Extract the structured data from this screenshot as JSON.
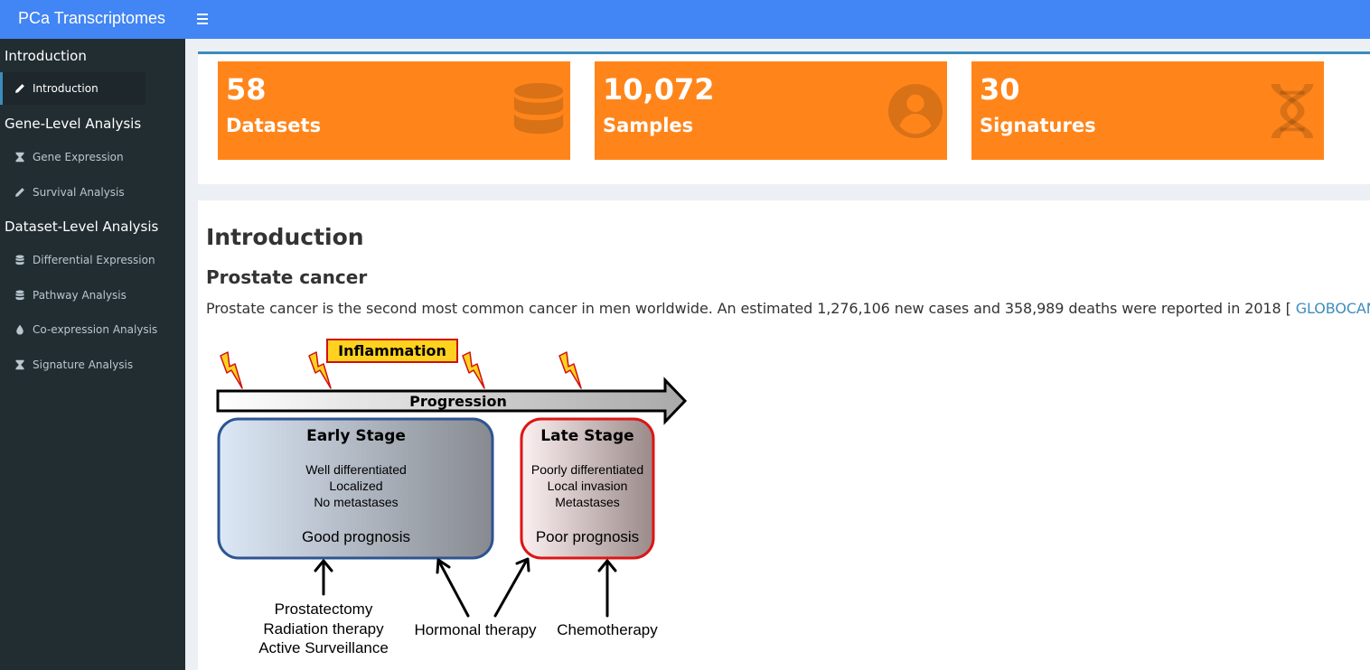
{
  "app": {
    "title": "PCa Transcriptomes"
  },
  "sidebar": {
    "sections": [
      {
        "label": "Introduction"
      },
      {
        "label": "Gene-Level Analysis"
      },
      {
        "label": "Dataset-Level Analysis"
      }
    ],
    "items": [
      {
        "label": "Introduction",
        "icon": "pencil-icon"
      },
      {
        "label": "Gene Expression",
        "icon": "hourglass-icon"
      },
      {
        "label": "Survival Analysis",
        "icon": "pencil-icon"
      },
      {
        "label": "Differential Expression",
        "icon": "database-icon"
      },
      {
        "label": "Pathway Analysis",
        "icon": "database-icon"
      },
      {
        "label": "Co-expression Analysis",
        "icon": "drop-icon"
      },
      {
        "label": "Signature Analysis",
        "icon": "hourglass-icon"
      }
    ]
  },
  "stats": [
    {
      "value": "58",
      "label": "Datasets",
      "icon": "database-icon"
    },
    {
      "value": "10,072",
      "label": "Samples",
      "icon": "user-icon"
    },
    {
      "value": "30",
      "label": "Signatures",
      "icon": "dna-icon"
    }
  ],
  "content": {
    "title": "Introduction",
    "subtitle": "Prostate cancer",
    "paragraph_text": "Prostate cancer is the second most common cancer in men worldwide. An estimated 1,276,106 new cases and 358,989 deaths were reported in 2018 [ ",
    "paragraph_link": "GLOBOCAN",
    "paragraph_end": " ]."
  },
  "figure": {
    "inflammation": "Inflammation",
    "progression": "Progression",
    "early": {
      "title": "Early Stage",
      "lines": [
        "Well differentiated",
        "Localized",
        "No metastases"
      ],
      "prognosis": "Good prognosis"
    },
    "late": {
      "title": "Late Stage",
      "lines": [
        "Poorly differentiated",
        "Local invasion",
        "Metastases"
      ],
      "prognosis": "Poor prognosis"
    },
    "treatments": {
      "early": [
        "Prostatectomy",
        "Radiation therapy",
        "Active Surveillance"
      ],
      "hormonal": "Hormonal therapy",
      "chemo": "Chemotherapy"
    }
  },
  "colors": {
    "header": "#4285f4",
    "sidebar": "#222d32",
    "value_box": "#ff851b",
    "link": "#3c8dbc"
  }
}
